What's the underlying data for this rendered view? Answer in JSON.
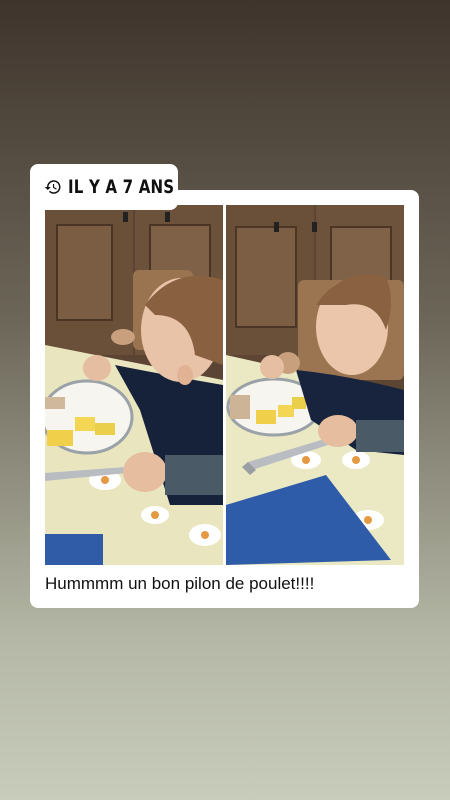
{
  "memory": {
    "label": "IL Y A 7 ANS",
    "icon": "history-clock-icon"
  },
  "photos": [
    {
      "name": "photo-left"
    },
    {
      "name": "photo-right"
    }
  ],
  "caption": "Hummmm un bon pilon de poulet!!!!"
}
